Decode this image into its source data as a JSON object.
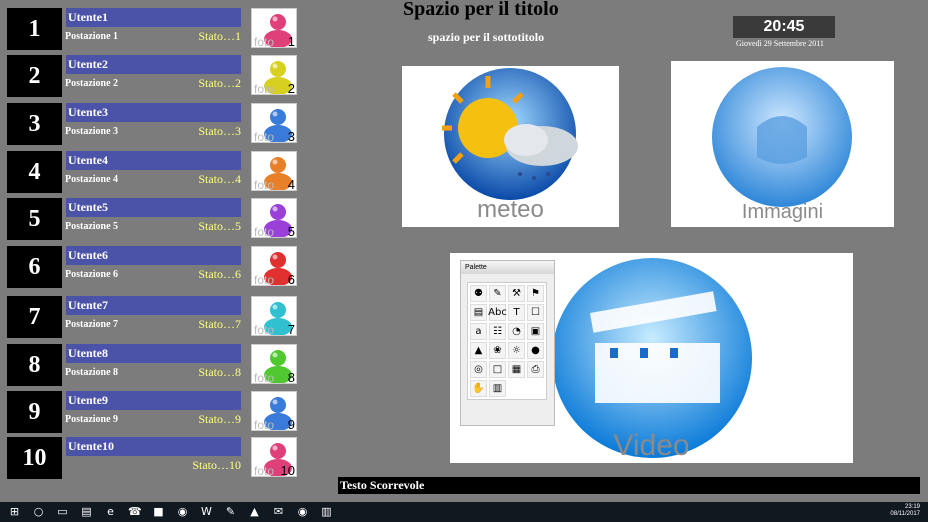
{
  "users": [
    {
      "num": "1",
      "name": "Utente1",
      "post": "Postazione 1",
      "stato": "Stato…1",
      "foto": "foto",
      "foto_num": "1",
      "color": "#e0407a"
    },
    {
      "num": "2",
      "name": "Utente2",
      "post": "Postazione 2",
      "stato": "Stato…2",
      "foto": "foto",
      "foto_num": "2",
      "color": "#d8d020"
    },
    {
      "num": "3",
      "name": "Utente3",
      "post": "Postazione 3",
      "stato": "Stato…3",
      "foto": "foto",
      "foto_num": "3",
      "color": "#3a7ad8"
    },
    {
      "num": "4",
      "name": "Utente4",
      "post": "Postazione 4",
      "stato": "Stato…4",
      "foto": "foto",
      "foto_num": "4",
      "color": "#e8802a"
    },
    {
      "num": "5",
      "name": "Utente5",
      "post": "Postazione 5",
      "stato": "Stato…5",
      "foto": "foto",
      "foto_num": "5",
      "color": "#9a40d8"
    },
    {
      "num": "6",
      "name": "Utente6",
      "post": "Postazione 6",
      "stato": "Stato…6",
      "foto": "foto",
      "foto_num": "6",
      "color": "#e03030"
    },
    {
      "num": "7",
      "name": "Utente7",
      "post": "Postazione 7",
      "stato": "Stato…7",
      "foto": "foto",
      "foto_num": "7",
      "color": "#30c0d0"
    },
    {
      "num": "8",
      "name": "Utente8",
      "post": "Postazione 8",
      "stato": "Stato…8",
      "foto": "foto",
      "foto_num": "8",
      "color": "#50c830"
    },
    {
      "num": "9",
      "name": "Utente9",
      "post": "Postazione 9",
      "stato": "Stato…9",
      "foto": "foto",
      "foto_num": "9",
      "color": "#3a7ad8"
    },
    {
      "num": "10",
      "name": "Utente10",
      "post": "",
      "stato": "Stato…10",
      "foto": "foto",
      "foto_num": "10",
      "color": "#e0407a"
    }
  ],
  "header": {
    "title": "Spazio per il titolo",
    "subtitle": "spazio per il sottotitolo",
    "clock": "20:45",
    "date": "Giovedì 29 Settembre 2011"
  },
  "cards": {
    "meteo": "meteo",
    "immagini": "Immagini",
    "video": "Video"
  },
  "palette": {
    "title": "Palette",
    "buttons": [
      "⚉",
      "✎",
      "⚒",
      "⚑",
      "▤",
      "Abc",
      "T",
      "☐",
      "a",
      "☷",
      "◔",
      "▣",
      "▲",
      "❀",
      "☼",
      "●",
      "◎",
      "□",
      "▦",
      "⎙",
      "✋",
      "▥"
    ]
  },
  "ticker": "Testo Scorrevole",
  "taskbar": {
    "icons": [
      "start-icon",
      "search-icon",
      "task-view-icon",
      "explorer-icon",
      "edge-icon",
      "whatsapp-icon",
      "app-icon",
      "chrome-icon",
      "word-icon",
      "paint-icon",
      "app2-icon",
      "mail-icon",
      "firefox-icon",
      "notepad-icon"
    ],
    "glyphs": [
      "⊞",
      "○",
      "▭",
      "▤",
      "e",
      "☎",
      "■",
      "◉",
      "W",
      "✎",
      "▲",
      "✉",
      "◉",
      "▥"
    ],
    "time": "23:19",
    "date": "08/11/2017"
  }
}
